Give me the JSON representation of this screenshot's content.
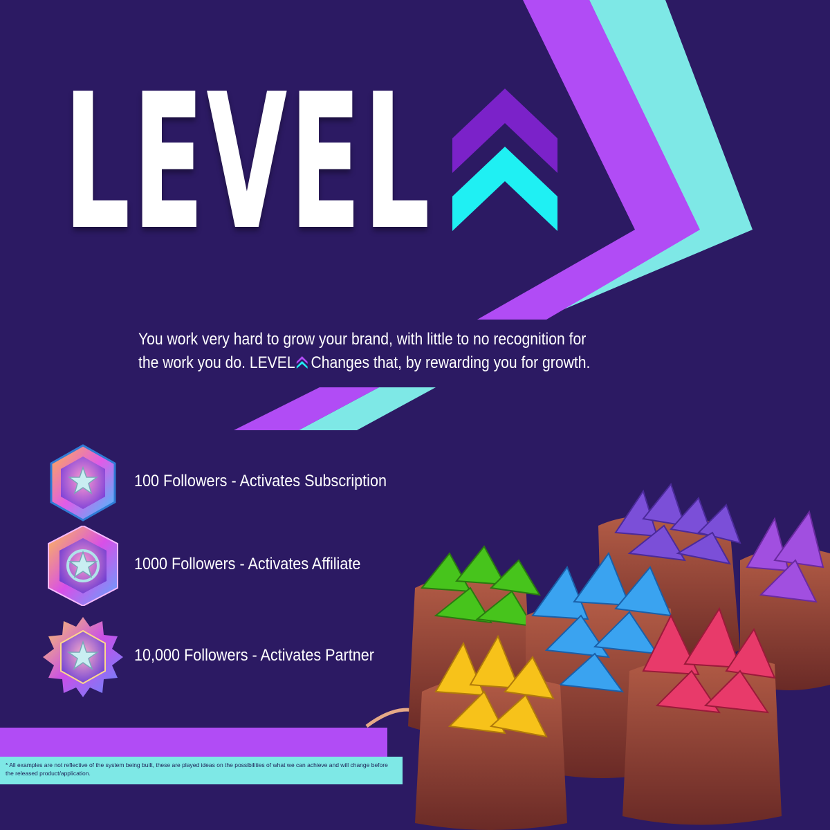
{
  "brand": {
    "title": "LEVEL",
    "colors": {
      "background": "#2c1a63",
      "purple": "#b14cf5",
      "cyan": "#7ee8e6",
      "chevron_purple": "#7b22c9",
      "chevron_cyan": "#1ff0f3"
    },
    "icon": "double-chevron-up-icon"
  },
  "intro": {
    "line1": "You work very hard to grow your brand, with little to no recognition for",
    "line2_before": "the work you do. LEVEL",
    "line2_after": "Changes that, by rewarding you for growth."
  },
  "tiers": [
    {
      "label": "100 Followers - Activates Subscription",
      "icon": "star-hexagon-badge-icon"
    },
    {
      "label": "1000 Followers - Activates Affiliate",
      "icon": "star-hexagon-badge-icon"
    },
    {
      "label": "10,000 Followers - Activates Partner",
      "icon": "star-spiked-badge-icon"
    }
  ],
  "footnote": "* All examples are not reflective of the system being built, these are played ideas on the possibilities of what we can achieve and will change before the released product/application.",
  "illustration": {
    "icon": "gem-sacks-illustration",
    "gem_colors": [
      "green",
      "blue",
      "purple",
      "violet",
      "yellow",
      "red"
    ]
  }
}
